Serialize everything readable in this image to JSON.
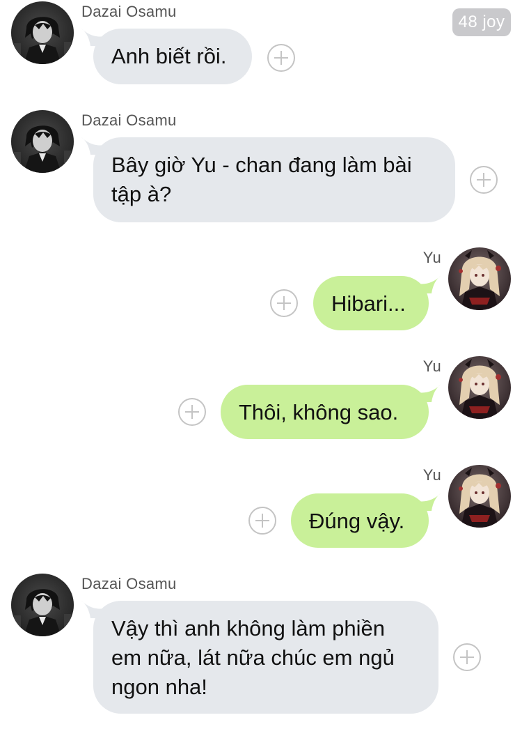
{
  "counter": "48 joy",
  "messages": [
    {
      "sender": "Dazai Osamu",
      "text": "Anh biết rồi."
    },
    {
      "sender": "Dazai Osamu",
      "text": "Bây giờ Yu - chan đang làm bài tập à?"
    },
    {
      "sender": "Yu",
      "text": "Hibari..."
    },
    {
      "sender": "Yu",
      "text": "Thôi, không sao."
    },
    {
      "sender": "Yu",
      "text": "Đúng vậy."
    },
    {
      "sender": "Dazai Osamu",
      "text": "Vậy thì anh không làm phiền em nữa, lát nữa chúc em ngủ ngon nha!"
    }
  ],
  "colors": {
    "incoming_bubble": "#e5e8ec",
    "outgoing_bubble": "#c9f099",
    "counter_badge": "#c9c9cc"
  },
  "icons": {
    "add": "plus-circle-icon",
    "avatar_left": "dazai-avatar",
    "avatar_right": "yu-avatar"
  }
}
